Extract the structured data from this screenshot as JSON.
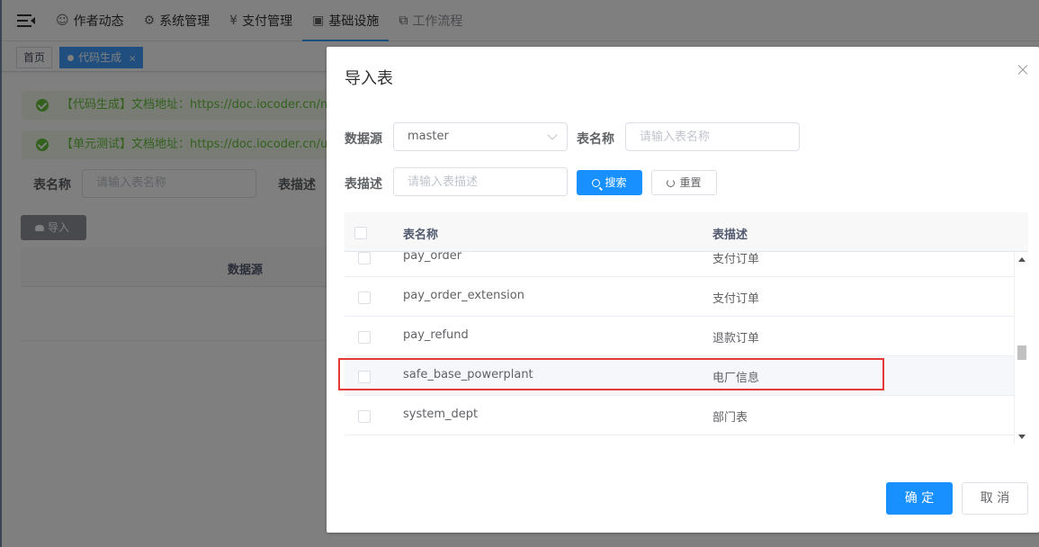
{
  "topnav": {
    "items": [
      {
        "label": "作者动态",
        "icon": "user-icon"
      },
      {
        "label": "系统管理",
        "icon": "gear-icon"
      },
      {
        "label": "支付管理",
        "icon": "yen-icon"
      },
      {
        "label": "基础设施",
        "icon": "monitor-icon",
        "active": true
      },
      {
        "label": "工作流程",
        "icon": "workflow-icon"
      }
    ]
  },
  "tags": {
    "home": "首页",
    "active": "代码生成",
    "close": "×"
  },
  "background": {
    "alert1": "【代码生成】文档地址：https://doc.iocoder.cn/new-",
    "alert2": "【单元测试】文档地址：https://doc.iocoder.cn/unit-",
    "table_name_label": "表名称",
    "table_name_placeholder": "请输入表名称",
    "table_desc_label": "表描述",
    "import_button": "导入",
    "col_datasource": "数据源"
  },
  "dialog": {
    "title": "导入表",
    "form": {
      "datasource_label": "数据源",
      "datasource_value": "master",
      "table_name_label": "表名称",
      "table_name_placeholder": "请输入表名称",
      "table_desc_label": "表描述",
      "table_desc_placeholder": "请输入表描述",
      "search_button": "搜索",
      "reset_button": "重置"
    },
    "table": {
      "columns": [
        "表名称",
        "表描述"
      ],
      "rows": [
        {
          "name": "pay_order",
          "desc": "支付订单"
        },
        {
          "name": "pay_order_extension",
          "desc": "支付订单"
        },
        {
          "name": "pay_refund",
          "desc": "退款订单"
        },
        {
          "name": "safe_base_powerplant",
          "desc": "电厂信息",
          "highlighted": true
        },
        {
          "name": "system_dept",
          "desc": "部门表"
        }
      ]
    },
    "confirm_button": "确 定",
    "cancel_button": "取 消"
  },
  "colors": {
    "primary": "#1890ff",
    "highlight_border": "#e53935",
    "success": "#67c23a"
  }
}
